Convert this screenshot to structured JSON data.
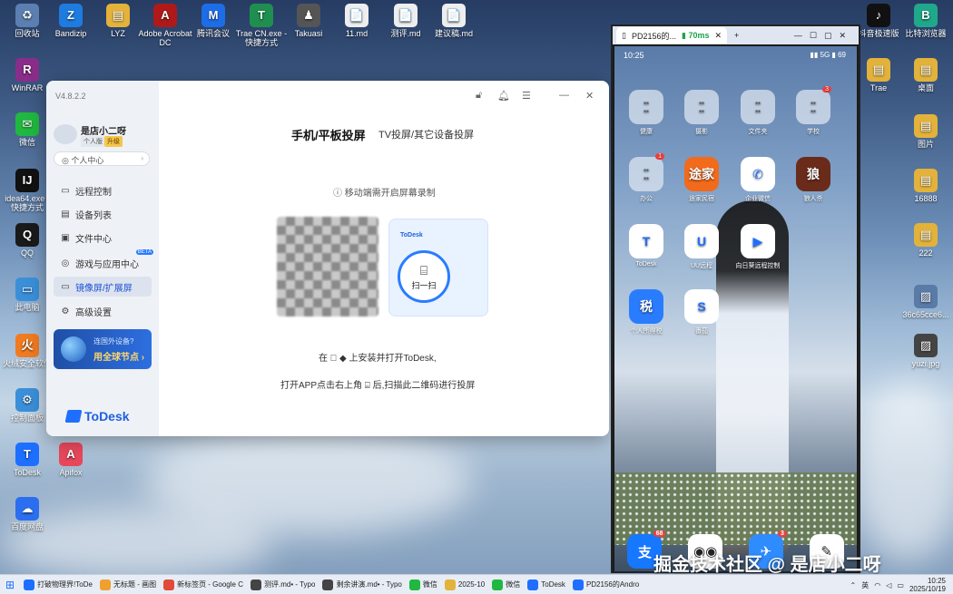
{
  "desktop": {
    "icons": [
      {
        "label": "回收站",
        "color": "#5b7fb0",
        "glyph": "♻"
      },
      {
        "label": "Bandizip",
        "color": "#1e7be0",
        "glyph": "Z"
      },
      {
        "label": "LYZ",
        "color": "#e2b23a",
        "glyph": "▤"
      },
      {
        "label": "Adobe Acrobat DC",
        "color": "#b01919",
        "glyph": "A"
      },
      {
        "label": "腾讯会议",
        "color": "#1d6de8",
        "glyph": "M"
      },
      {
        "label": "Trae CN.exe - 快捷方式",
        "color": "#1f8f4f",
        "glyph": "T"
      },
      {
        "label": "Takuasi",
        "color": "#555",
        "glyph": "♟"
      },
      {
        "label": "11.md",
        "color": "#eee",
        "glyph": "📄"
      },
      {
        "label": "测评.md",
        "color": "#eee",
        "glyph": "📄"
      },
      {
        "label": "建议稿.md",
        "color": "#eee",
        "glyph": "📄"
      },
      {
        "label": "WinRAR",
        "color": "#8a2d8a",
        "glyph": "R"
      },
      {
        "label": "微信",
        "color": "#20b840",
        "glyph": "✉"
      },
      {
        "label": "idea64.exe - 快捷方式",
        "color": "#111",
        "glyph": "IJ"
      },
      {
        "label": "QQ",
        "color": "#1a1a1a",
        "glyph": "Q"
      },
      {
        "label": "此电脑",
        "color": "#3b8fd8",
        "glyph": "▭"
      },
      {
        "label": "火绒安全软件",
        "color": "#f07b21",
        "glyph": "火"
      },
      {
        "label": "控制面板",
        "color": "#3b8fd8",
        "glyph": "⚙"
      },
      {
        "label": "ToDesk",
        "color": "#1e6fff",
        "glyph": "T"
      },
      {
        "label": "Apifox",
        "color": "#e8475b",
        "glyph": "A"
      },
      {
        "label": "百度网盘",
        "color": "#2b6ff0",
        "glyph": "☁"
      },
      {
        "label": "Trae",
        "color": "#e2b23a",
        "glyph": "▤"
      },
      {
        "label": "桌面",
        "color": "#e2b23a",
        "glyph": "▤"
      },
      {
        "label": "图片",
        "color": "#e2b23a",
        "glyph": "▤"
      },
      {
        "label": "16888",
        "color": "#e2b23a",
        "glyph": "▤"
      },
      {
        "label": "222",
        "color": "#e2b23a",
        "glyph": "▤"
      },
      {
        "label": "36c65cce6...",
        "color": "#5a7ba8",
        "glyph": "▨"
      },
      {
        "label": "yuzi.jpg",
        "color": "#444",
        "glyph": "▨"
      },
      {
        "label": "抖音极速版",
        "color": "#111",
        "glyph": "♪"
      },
      {
        "label": "比特浏览器",
        "color": "#20a88a",
        "glyph": "B"
      }
    ]
  },
  "main_window": {
    "version": "V4.8.2.2",
    "user": {
      "name": "是店小二呀",
      "tag_personal": "个人版",
      "tag_upgrade": "升级"
    },
    "personal_center": "个人中心",
    "nav": [
      {
        "icon": "▭",
        "label": "远程控制"
      },
      {
        "icon": "▤",
        "label": "设备列表"
      },
      {
        "icon": "▣",
        "label": "文件中心"
      },
      {
        "icon": "◎",
        "label": "游戏与应用中心",
        "badge": "BETA"
      },
      {
        "icon": "▭",
        "label": "镜像屏/扩展屏"
      },
      {
        "icon": "⚙",
        "label": "高级设置"
      }
    ],
    "promo": {
      "line1": "连国外设备?",
      "line2": "用全球节点 ›"
    },
    "brand": "ToDesk",
    "tabs": {
      "active": "手机/平板投屏",
      "other": "TV投屏/其它设备投屏"
    },
    "note": "ⓘ 移动端需开启屏幕录制",
    "phone_card": {
      "header": "ToDesk",
      "scan_label": "扫一扫"
    },
    "instruction1": "在    ◆  上安装并打开ToDesk,",
    "instruction2": "打开APP点击右上角  ⌸  后,扫描此二维码进行投屏"
  },
  "mirror": {
    "tab_title": "PD2156的...",
    "ping": "70ms",
    "status_time": "10:25",
    "status_right": "▮▮ 5G ▮ 69",
    "apps": [
      {
        "label": "健康",
        "type": "folder"
      },
      {
        "label": "摄影",
        "type": "folder"
      },
      {
        "label": "文件夹",
        "type": "folder"
      },
      {
        "label": "学校",
        "type": "folder",
        "badge": "3"
      },
      {
        "label": "办公",
        "type": "folder",
        "badge": "1"
      },
      {
        "label": "途家民宿",
        "text": "途家",
        "color": "#f26a1b"
      },
      {
        "label": "企业微信",
        "text": "✆",
        "color": "#ffffff"
      },
      {
        "label": "狼人杀",
        "text": "狼",
        "color": "#6a2b1a"
      },
      {
        "label": "ToDesk",
        "text": "T",
        "color": "#ffffff"
      },
      {
        "label": "UU远程",
        "text": "U",
        "color": "#ffffff"
      },
      {
        "label": "向日葵远程控制",
        "text": "▶",
        "color": "#ffffff"
      },
      {
        "label": "个人所得税",
        "text": "税",
        "color": "#2a7cff"
      },
      {
        "label": "番茄",
        "text": "S",
        "color": "#ffffff"
      }
    ],
    "dock": [
      {
        "text": "支",
        "color": "#1677ff",
        "badge": "68"
      },
      {
        "text": "◉◉",
        "color": "#ffffff"
      },
      {
        "text": "✈",
        "color": "#2f8cff",
        "badge": "3"
      },
      {
        "text": "✎",
        "color": "#ffffff"
      }
    ]
  },
  "watermark": "掘金技术社区 @ 是店小二呀",
  "taskbar": {
    "items": [
      {
        "label": "打破物理界!ToDe",
        "color": "#1e6fff"
      },
      {
        "label": "无标题 - 画图",
        "color": "#f0a030"
      },
      {
        "label": "新标签页 - Google C",
        "color": "#e24b3b"
      },
      {
        "label": "测评.md• - Typo",
        "color": "#444"
      },
      {
        "label": "剩余讲演.md• - Typo",
        "color": "#444"
      },
      {
        "label": "微信",
        "color": "#20b840"
      },
      {
        "label": "2025-10",
        "color": "#e2b23a"
      },
      {
        "label": "微信",
        "color": "#20b840"
      },
      {
        "label": "ToDesk",
        "color": "#1e6fff"
      },
      {
        "label": "PD2156的Andro",
        "color": "#1e6fff"
      }
    ],
    "lang": "英",
    "time": "10:25",
    "date": "2025/10/19"
  }
}
